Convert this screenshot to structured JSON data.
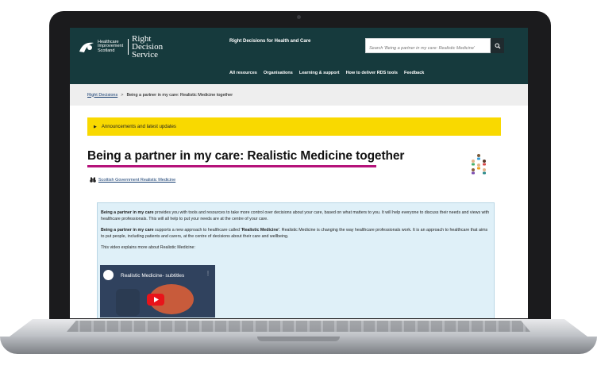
{
  "header": {
    "logo_org": "Healthcare Improvement Scotland",
    "logo_service": "Right Decision Service",
    "site_name": "Right Decisions for Health and Care",
    "search_placeholder": "Search 'Being a partner in my care: Realistic Medicine'",
    "nav": [
      "All resources",
      "Organisations",
      "Learning & support",
      "How to deliver RDS tools",
      "Feedback"
    ]
  },
  "breadcrumb": {
    "home": "Right Decisions",
    "separator": ">",
    "current": "Being a partner in my care: Realistic Medicine together"
  },
  "announcement": "Announcements and latest updates",
  "page": {
    "title": "Being a partner in my care: Realistic Medicine together",
    "source": "Scottish Government Realistic Medicine"
  },
  "content": {
    "p1_bold": "Being a partner in my care",
    "p1_rest": " provides you with tools and resources to take more control over decisions about your care, based on what matters to you. It will help everyone to discuss their needs and views with healthcare professionals. This will all help to put your needs are at the centre of your care.",
    "p2_bold": "Being a partner in my care",
    "p2_mid": " supports a new approach to healthcare called ",
    "p2_bold2": "'Realistic Medicine'",
    "p2_rest": ". Realistic Medicine is changing the way healthcare professionals work.  It is an approach to healthcare that aims to put people, including patients and carers, at the centre of decisions about their care and wellbeing.",
    "p3": "This video explains more about Realistic Medicine:",
    "video_title": "Realistic Medicine- subtitles"
  },
  "colors": {
    "header_bg": "#163a3d",
    "announcement_bg": "#f9d900",
    "title_underline": "#b5127a",
    "content_bg": "#dff0f8"
  }
}
